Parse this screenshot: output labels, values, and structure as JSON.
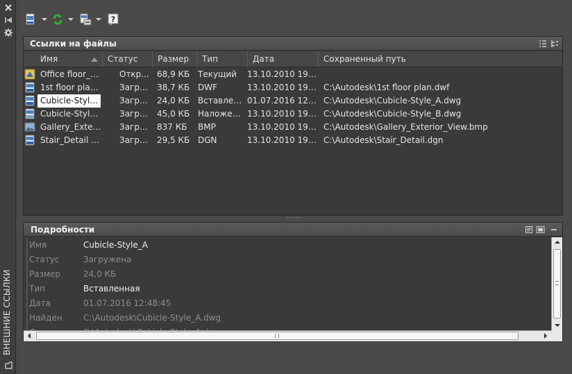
{
  "sidebar": {
    "vertical_title": "ВНЕШНИЕ ССЫЛКИ"
  },
  "toolbar": {
    "attach_button": "attach-dwg-icon",
    "refresh_button": "refresh-icon",
    "change_path_button": "change-path-icon",
    "help_button": "help-icon",
    "accent_green": "#2fb12f"
  },
  "file_refs": {
    "title": "Ссылки на файлы",
    "columns": [
      "Имя",
      "Статус",
      "Размер",
      "Тип",
      "Дата",
      "Сохраненный путь"
    ],
    "rows": [
      {
        "icon": "drawing-icon",
        "name": "Office floor_p...",
        "status": "Откр...",
        "size": "68,9 КБ",
        "type": "Текущий",
        "date": "13.10.2010 19:07:...",
        "path": ""
      },
      {
        "icon": "dwf-icon",
        "name": "1st floor plan ...",
        "status": "Загру...",
        "size": "38,7 КБ",
        "type": "DWF",
        "date": "13.10.2010 19:07:...",
        "path": "C:\\Autodesk\\1st floor plan.dwf"
      },
      {
        "icon": "dwg-icon",
        "name": "Cubicle-Style_A",
        "status": "Загру...",
        "size": "24,0 КБ",
        "type": "Вставлен...",
        "date": "01.07.2016 12:48:...",
        "path": "C:\\Autodesk\\Cubicle-Style_A.dwg",
        "selected": true
      },
      {
        "icon": "dwg-overlay-icon",
        "name": "Cubicle-Style_B",
        "status": "Загру...",
        "size": "45,0 КБ",
        "type": "Наложен...",
        "date": "13.10.2010 19:07:...",
        "path": "C:\\Autodesk\\Cubicle-Style_B.dwg"
      },
      {
        "icon": "image-icon",
        "name": "Gallery_Exteri...",
        "status": "Загру...",
        "size": "837 КБ",
        "type": "BMP",
        "date": "13.10.2010 19:07:...",
        "path": "C:\\Autodesk\\Gallery_Exterior_View.bmp"
      },
      {
        "icon": "dgn-icon",
        "name": "Stair_Detail - ...",
        "status": "Загру...",
        "size": "29,5 КБ",
        "type": "DGN",
        "date": "13.10.2010 19:07:...",
        "path": "C:\\Autodesk\\Stair_Detail.dgn"
      }
    ]
  },
  "details": {
    "title": "Подробности",
    "fields": [
      {
        "label": "Имя",
        "value": "Cubicle-Style_A",
        "active": true
      },
      {
        "label": "Статус",
        "value": "Загружена",
        "active": false
      },
      {
        "label": "Размер",
        "value": "24,0 КБ",
        "active": false
      },
      {
        "label": "Тип",
        "value": "Вставленная",
        "active": true
      },
      {
        "label": "Дата",
        "value": "01.07.2016 12:48:45",
        "active": false
      },
      {
        "label": "Найден в",
        "value": "C:\\Autodesk\\Cubicle-Style_A.dwg",
        "active": false
      },
      {
        "label": "С...",
        "value": "C:\\Autodesk\\Cubicle-Style_A.dwg",
        "active": false
      }
    ]
  }
}
